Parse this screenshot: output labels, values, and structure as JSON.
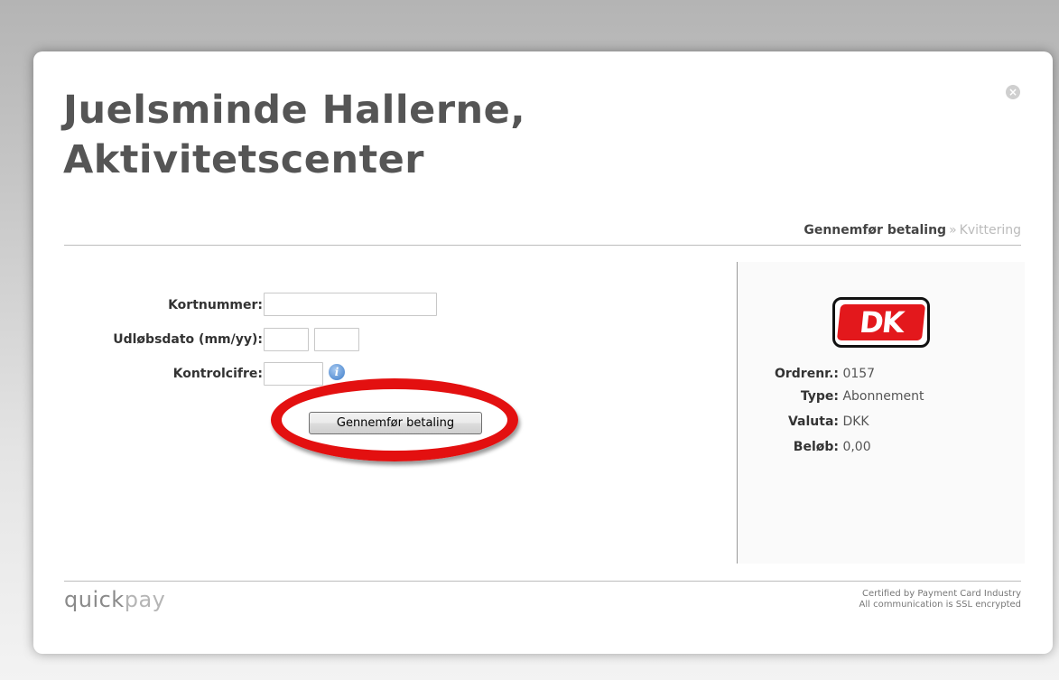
{
  "modal": {
    "title_line1": "Juelsminde Hallerne,",
    "title_line2": "Aktivitetscenter",
    "close_icon": "close-icon"
  },
  "steps": {
    "current": "Gennemfør betaling",
    "separator": "»",
    "next": "Kvittering"
  },
  "form": {
    "card_number_label": "Kortnummer:",
    "card_number_value": "",
    "expiry_label": "Udløbsdato (mm/yy):",
    "expiry_month_value": "",
    "expiry_year_value": "",
    "cvc_label": "Kontrolcifre:",
    "cvc_value": "",
    "info_icon": "info-icon",
    "submit_label": "Gennemfør betaling"
  },
  "card_logo": {
    "text": "DK",
    "color": "#e3181c"
  },
  "order": {
    "order_no_label": "Ordrenr.:",
    "order_no_value": "0157",
    "type_label": "Type:",
    "type_value": "Abonnement",
    "currency_label": "Valuta:",
    "currency_value": "DKK",
    "amount_label": "Beløb:",
    "amount_value": "0,00"
  },
  "footer": {
    "brand_part1": "quick",
    "brand_part2": "pay",
    "cert_line1": "Certified by Payment Card Industry",
    "cert_line2": "All communication is SSL encrypted"
  },
  "highlight_color": "#e31010"
}
